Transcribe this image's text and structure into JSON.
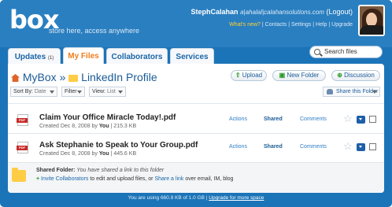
{
  "header": {
    "logo": "box",
    "tagline": "store here, access anywhere",
    "user_name": "StephCalahan",
    "user_email": "a|ahalal|calahansolutions.com",
    "logout": "(Logout)",
    "links": {
      "whats_new": "What's new?",
      "contacts": "Contacts",
      "settings": "Settings",
      "help": "Help",
      "upgrade": "Upgrade"
    }
  },
  "tabs": [
    {
      "label": "Updates",
      "count": "(1)"
    },
    {
      "label": "My Files",
      "active": true
    },
    {
      "label": "Collaborators"
    },
    {
      "label": "Services"
    }
  ],
  "search": {
    "placeholder": "Search files"
  },
  "breadcrumb": {
    "root": "MyBox",
    "separator": "»",
    "folder": "LinkedIn Profile"
  },
  "buttons": {
    "upload": "Upload",
    "new_folder": "New Folder",
    "discussion": "Discussion"
  },
  "toolbar": {
    "sort_label": "Sort By:",
    "sort_value": "Date",
    "filter": "Filter",
    "view_label": "View:",
    "view_value": "List",
    "share_folder": "Share this Folder"
  },
  "files": [
    {
      "icon": "pdf-icon",
      "type_badge": "PDF",
      "name": "Claim Your Office Miracle Today!.pdf",
      "created": "Created Dec 8, 2008 by",
      "owner": "You",
      "size": "215.3 KB",
      "actions": "Actions",
      "shared": "Shared",
      "comments": "Comments"
    },
    {
      "icon": "pdf-icon",
      "type_badge": "PDF",
      "name": "Ask Stephanie to Speak to Your Group.pdf",
      "created": "Created Dec 8, 2008 by",
      "owner": "You",
      "size": "445.6 KB",
      "actions": "Actions",
      "shared": "Shared",
      "comments": "Comments"
    }
  ],
  "shared_folder": {
    "label": "Shared Folder:",
    "desc": "You have shared a link to this folder",
    "invite": "Invite Collaborators",
    "mid": "to edit and upload files, or",
    "share_link": "Share a link",
    "tail": "over email, IM, blog"
  },
  "footer": {
    "usage": "You are using 660.9 KB of 1.0 GB",
    "upgrade": "Upgrade for more space"
  },
  "colors": {
    "brand_blue": "#1b74b8",
    "active_tab": "#f07d1a",
    "link": "#2e7cc4"
  }
}
